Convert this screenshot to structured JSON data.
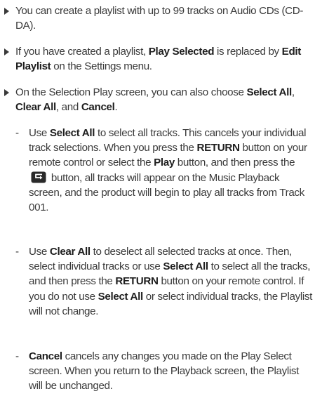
{
  "bullets": [
    {
      "segments": [
        {
          "t": "You can create a playlist with up to 99 tracks on Audio CDs (CD-DA)."
        }
      ]
    },
    {
      "segments": [
        {
          "t": "If you have created a playlist, "
        },
        {
          "t": "Play Selected",
          "b": true
        },
        {
          "t": " is replaced by "
        },
        {
          "t": "Edit Playlist",
          "b": true
        },
        {
          "t": " on the Settings menu."
        }
      ]
    },
    {
      "segments": [
        {
          "t": "On the Selection Play screen, you can also choose "
        },
        {
          "t": "Select All",
          "b": true
        },
        {
          "t": ", "
        },
        {
          "t": "Clear All",
          "b": true
        },
        {
          "t": ", and "
        },
        {
          "t": "Cancel",
          "b": true
        },
        {
          "t": "."
        }
      ]
    }
  ],
  "subitems": [
    {
      "dash": "-",
      "segments": [
        {
          "t": "Use "
        },
        {
          "t": "Select All",
          "b": true
        },
        {
          "t": " to select all tracks. This cancels your individual track selections. When you press the "
        },
        {
          "t": "RETURN",
          "b": true
        },
        {
          "t": " button on your remote control or select the "
        },
        {
          "t": "Play",
          "b": true
        },
        {
          "t": " button, and then press the "
        },
        {
          "icon": "return-button-icon"
        },
        {
          "t": " button, all tracks will appear on the Music Playback screen, and the product will begin to play all tracks from Track 001."
        }
      ]
    },
    {
      "dash": "-",
      "segments": [
        {
          "t": "Use "
        },
        {
          "t": "Clear All",
          "b": true
        },
        {
          "t": " to deselect all selected tracks at once. Then, select individual tracks or use "
        },
        {
          "t": "Select All",
          "b": true
        },
        {
          "t": " to select all the tracks, and then press the "
        },
        {
          "t": "RETURN",
          "b": true
        },
        {
          "t": " button on your remote control. If you do not use "
        },
        {
          "t": "Select All",
          "b": true
        },
        {
          "t": " or select individual tracks, the Playlist will not change."
        }
      ]
    },
    {
      "dash": "-",
      "segments": [
        {
          "t": "Cancel",
          "b": true
        },
        {
          "t": " cancels any changes you made on the Play Select screen. When you return to the Playback screen, the Playlist will be unchanged."
        }
      ]
    }
  ]
}
